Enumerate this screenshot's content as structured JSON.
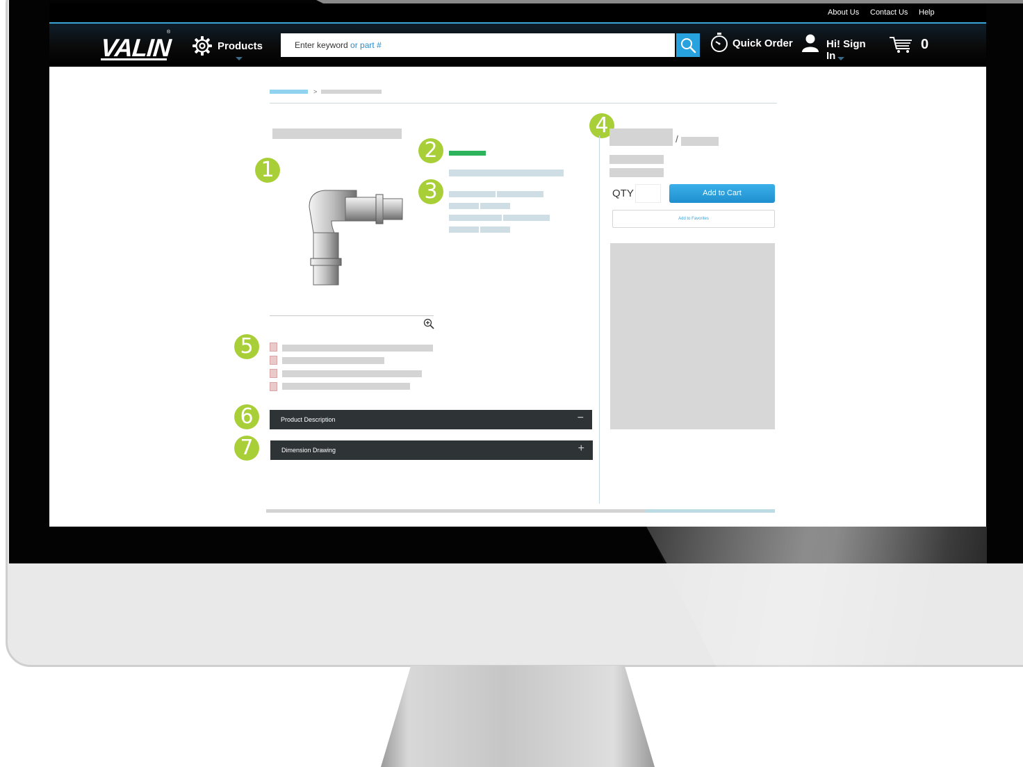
{
  "utility_nav": {
    "about": "About Us",
    "contact": "Contact Us",
    "help": "Help"
  },
  "brand": {
    "logo_text": "VALIN",
    "registered": "®"
  },
  "header": {
    "products_label": "Products",
    "search_placeholder_part1": "Enter keyword",
    "search_placeholder_part2": "or part #",
    "quick_order_label": "Quick Order",
    "sign_in_label": "Hi! Sign In",
    "cart_count": "0"
  },
  "breadcrumb": {
    "separator": ">"
  },
  "purchase": {
    "price_separator": "/",
    "qty_label": "QTY",
    "add_to_cart_label": "Add to Cart",
    "add_to_favorites_label": "Add to Favorites"
  },
  "accordions": [
    {
      "label": "Product Description",
      "symbol": "−"
    },
    {
      "label": "Dimension Drawing",
      "symbol": "+"
    }
  ],
  "markers": [
    "1",
    "2",
    "3",
    "4",
    "5",
    "6",
    "7"
  ],
  "colors": {
    "accent_blue": "#27a2df",
    "marker_green": "#a9cf38",
    "stock_green": "#2db35b",
    "accordion_dark": "#2e3336"
  },
  "icons": [
    "gear-icon",
    "search-icon",
    "stopwatch-icon",
    "user-icon",
    "cart-icon",
    "zoom-in-icon",
    "pdf-icon"
  ]
}
